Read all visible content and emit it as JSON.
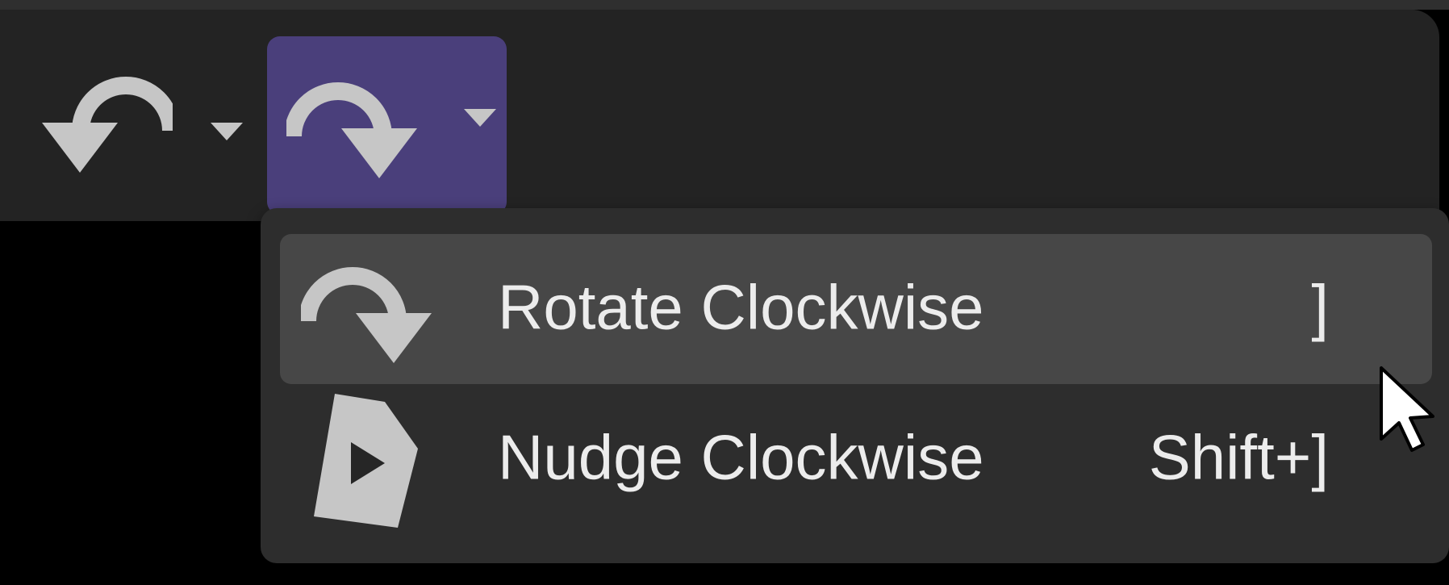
{
  "toolbar": {
    "rotate_left_icon": "rotate-counterclockwise-icon",
    "rotate_right_icon": "rotate-clockwise-icon",
    "dropdown_icon": "chevron-down-icon",
    "active_color": "#4a3f7b"
  },
  "menu": {
    "items": [
      {
        "icon": "rotate-clockwise-icon",
        "label": "Rotate Clockwise",
        "shortcut": "]",
        "highlighted": true
      },
      {
        "icon": "nudge-clockwise-icon",
        "label": "Nudge Clockwise",
        "shortcut": "Shift+]",
        "highlighted": false
      }
    ]
  },
  "colors": {
    "background": "#000000",
    "toolbar": "#232323",
    "menu": "#2d2d2d",
    "menu_highlight": "#474747",
    "text": "#ececec",
    "icon": "#c6c6c6"
  }
}
